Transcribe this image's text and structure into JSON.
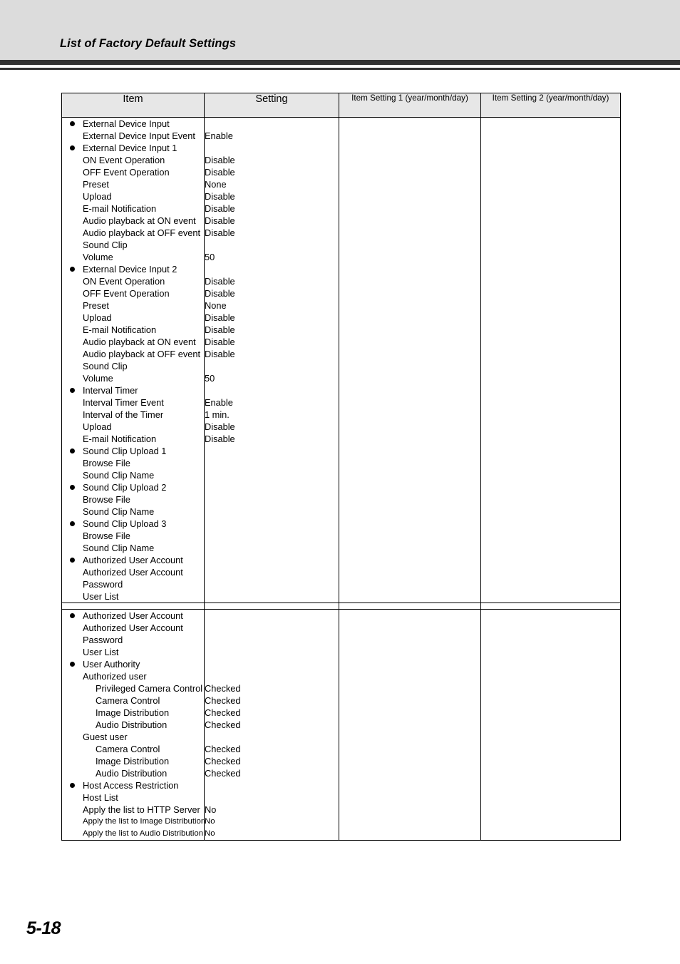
{
  "header": {
    "title": "List of Factory Default Settings"
  },
  "table": {
    "columns": [
      {
        "label": "Item",
        "size": "normal"
      },
      {
        "label": "Setting",
        "size": "normal"
      },
      {
        "label": "Item Setting 1 (year/month/day)",
        "size": "small"
      },
      {
        "label": "Item Setting 2 (year/month/day)",
        "size": "small"
      }
    ],
    "blocks": [
      {
        "rows": [
          {
            "item": "External Device Input",
            "level": "bullet",
            "setting": ""
          },
          {
            "item": "External Device Input Event",
            "level": 1,
            "setting": "Enable"
          },
          {
            "item": "External Device Input 1",
            "level": "bullet",
            "setting": ""
          },
          {
            "item": "ON Event Operation",
            "level": 1,
            "setting": "Disable"
          },
          {
            "item": "OFF Event Operation",
            "level": 1,
            "setting": "Disable"
          },
          {
            "item": "Preset",
            "level": 1,
            "setting": "None"
          },
          {
            "item": "Upload",
            "level": 1,
            "setting": "Disable"
          },
          {
            "item": "E-mail Notification",
            "level": 1,
            "setting": "Disable"
          },
          {
            "item": "Audio playback at ON event",
            "level": 1,
            "setting": "Disable"
          },
          {
            "item": "Audio playback at OFF event",
            "level": 1,
            "setting": "Disable"
          },
          {
            "item": "Sound Clip",
            "level": 1,
            "setting": ""
          },
          {
            "item": "Volume",
            "level": 1,
            "setting": "50"
          },
          {
            "item": "External Device Input 2",
            "level": "bullet",
            "setting": ""
          },
          {
            "item": "ON Event Operation",
            "level": 1,
            "setting": "Disable"
          },
          {
            "item": "OFF Event Operation",
            "level": 1,
            "setting": "Disable"
          },
          {
            "item": "Preset",
            "level": 1,
            "setting": "None"
          },
          {
            "item": "Upload",
            "level": 1,
            "setting": "Disable"
          },
          {
            "item": "E-mail Notification",
            "level": 1,
            "setting": "Disable"
          },
          {
            "item": "Audio playback at ON event",
            "level": 1,
            "setting": "Disable"
          },
          {
            "item": "Audio playback at OFF event",
            "level": 1,
            "setting": "Disable"
          },
          {
            "item": "Sound Clip",
            "level": 1,
            "setting": ""
          },
          {
            "item": "Volume",
            "level": 1,
            "setting": "50"
          },
          {
            "item": "Interval Timer",
            "level": "bullet",
            "setting": ""
          },
          {
            "item": "Interval Timer Event",
            "level": 1,
            "setting": "Enable"
          },
          {
            "item": "Interval of the Timer",
            "level": 1,
            "setting": "1 min."
          },
          {
            "item": "Upload",
            "level": 1,
            "setting": "Disable"
          },
          {
            "item": "E-mail Notification",
            "level": 1,
            "setting": "Disable"
          },
          {
            "item": "Sound Clip Upload 1",
            "level": "bullet",
            "setting": ""
          },
          {
            "item": "Browse File",
            "level": 1,
            "setting": ""
          },
          {
            "item": "Sound Clip Name",
            "level": 1,
            "setting": ""
          },
          {
            "item": "Sound Clip Upload 2",
            "level": "bullet",
            "setting": ""
          },
          {
            "item": "Browse File",
            "level": 1,
            "setting": ""
          },
          {
            "item": "Sound Clip Name",
            "level": 1,
            "setting": ""
          },
          {
            "item": "Sound Clip Upload 3",
            "level": "bullet",
            "setting": ""
          },
          {
            "item": "Browse File",
            "level": 1,
            "setting": ""
          },
          {
            "item": "Sound Clip Name",
            "level": 1,
            "setting": ""
          },
          {
            "item": "Authorized User Account",
            "level": "bullet",
            "setting": ""
          },
          {
            "item": "Authorized User Account",
            "level": 1,
            "setting": ""
          },
          {
            "item": "Password",
            "level": 1,
            "setting": ""
          },
          {
            "item": "User List",
            "level": 1,
            "setting": ""
          }
        ]
      },
      {
        "rows": [
          {
            "item": "Authorized User Account",
            "level": "bullet",
            "setting": ""
          },
          {
            "item": "Authorized User Account",
            "level": 1,
            "setting": ""
          },
          {
            "item": "Password",
            "level": 1,
            "setting": ""
          },
          {
            "item": "User List",
            "level": 1,
            "setting": ""
          },
          {
            "item": "User Authority",
            "level": "bullet",
            "setting": ""
          },
          {
            "item": "Authorized user",
            "level": 1,
            "setting": ""
          },
          {
            "item": "Privileged Camera Control",
            "level": 2,
            "setting": "Checked"
          },
          {
            "item": "Camera Control",
            "level": 2,
            "setting": "Checked"
          },
          {
            "item": "Image Distribution",
            "level": 2,
            "setting": "Checked"
          },
          {
            "item": "Audio Distribution",
            "level": 2,
            "setting": "Checked"
          },
          {
            "item": "Guest user",
            "level": 1,
            "setting": ""
          },
          {
            "item": "Camera Control",
            "level": 2,
            "setting": "Checked"
          },
          {
            "item": "Image Distribution",
            "level": 2,
            "setting": "Checked"
          },
          {
            "item": "Audio Distribution",
            "level": 2,
            "setting": "Checked"
          },
          {
            "item": "Host Access Restriction",
            "level": "bullet",
            "setting": ""
          },
          {
            "item": "Host List",
            "level": 1,
            "setting": ""
          },
          {
            "item": "Apply the list to HTTP Server",
            "level": 1,
            "setting": "No"
          },
          {
            "item": "Apply the list to Image Distribution",
            "level": 1,
            "setting": "No",
            "condensed": true
          },
          {
            "item": "Apply the list to Audio Distribution",
            "level": 1,
            "setting": "No",
            "condensed": true
          }
        ]
      }
    ]
  },
  "footer": {
    "page_number": "5-18"
  }
}
